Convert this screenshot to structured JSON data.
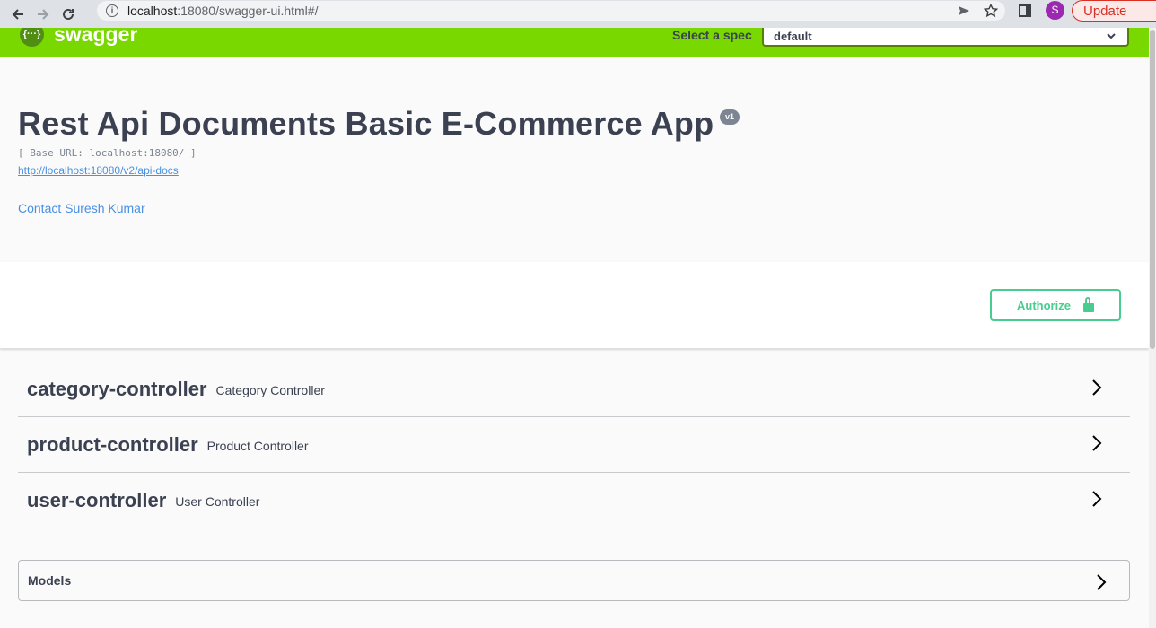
{
  "browser": {
    "url_host": "localhost",
    "url_rest": ":18080/swagger-ui.html#/",
    "avatar_letter": "S",
    "update_label": "Update"
  },
  "topbar": {
    "logo_mark": "{···}",
    "logo_text": "swagger",
    "spec_label": "Select a spec",
    "spec_value": "default"
  },
  "info": {
    "title": "Rest Api Documents Basic E-Commerce App",
    "version": "v1",
    "base_url": "[ Base URL: localhost:18080/ ]",
    "api_docs_link": "http://localhost:18080/v2/api-docs",
    "contact_link": "Contact Suresh Kumar"
  },
  "auth": {
    "authorize_label": "Authorize"
  },
  "tags": [
    {
      "name": "category-controller",
      "description": "Category Controller"
    },
    {
      "name": "product-controller",
      "description": "Product Controller"
    },
    {
      "name": "user-controller",
      "description": "User Controller"
    }
  ],
  "models": {
    "label": "Models"
  },
  "colors": {
    "topbar": "#78d800",
    "authorize": "#49cc90",
    "link": "#4990e2"
  }
}
